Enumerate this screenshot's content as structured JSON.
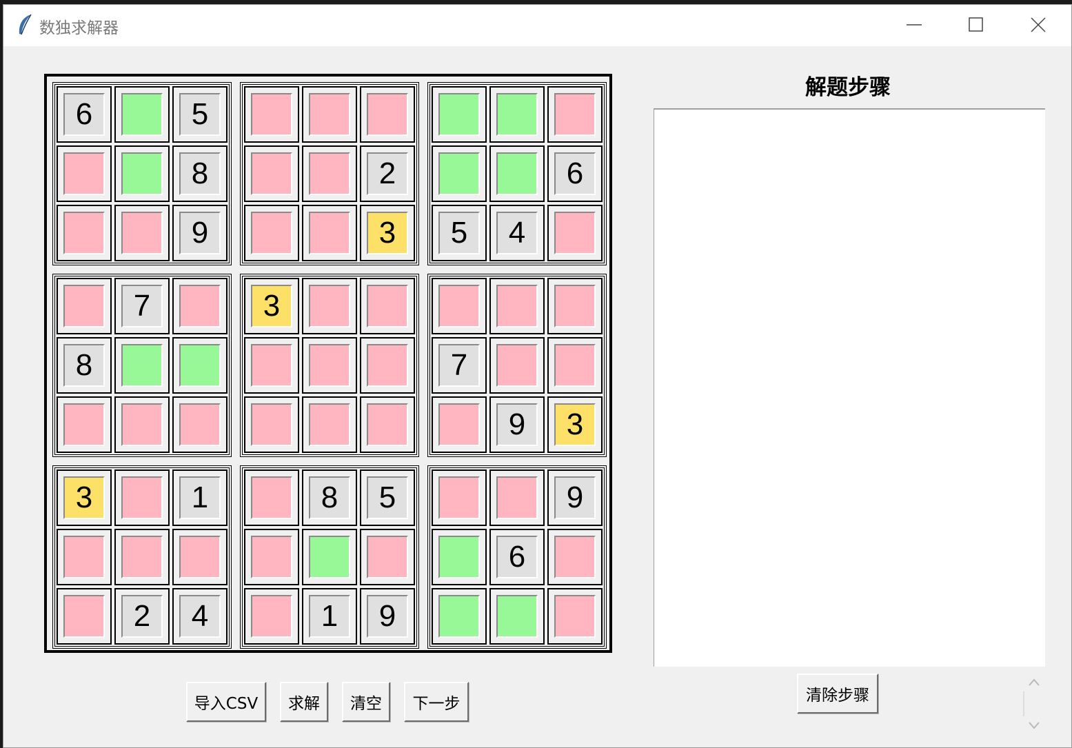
{
  "window": {
    "title": "数独求解器",
    "controls": {
      "minimize_icon": "minimize-icon",
      "maximize_icon": "maximize-icon",
      "close_icon": "close-icon"
    }
  },
  "colors": {
    "given": "#e0e0e0",
    "candidate_green": "#98f898",
    "empty_pink": "#ffb6c1",
    "highlight_yellow": "#fde068"
  },
  "board": {
    "rows": [
      [
        {
          "v": "6",
          "s": "given"
        },
        {
          "v": "",
          "s": "green"
        },
        {
          "v": "5",
          "s": "given"
        },
        {
          "v": "",
          "s": "pink"
        },
        {
          "v": "",
          "s": "pink"
        },
        {
          "v": "",
          "s": "pink"
        },
        {
          "v": "",
          "s": "green"
        },
        {
          "v": "",
          "s": "green"
        },
        {
          "v": "",
          "s": "pink"
        }
      ],
      [
        {
          "v": "",
          "s": "pink"
        },
        {
          "v": "",
          "s": "green"
        },
        {
          "v": "8",
          "s": "given"
        },
        {
          "v": "",
          "s": "pink"
        },
        {
          "v": "",
          "s": "pink"
        },
        {
          "v": "2",
          "s": "given"
        },
        {
          "v": "",
          "s": "green"
        },
        {
          "v": "",
          "s": "green"
        },
        {
          "v": "6",
          "s": "given"
        }
      ],
      [
        {
          "v": "",
          "s": "pink"
        },
        {
          "v": "",
          "s": "pink"
        },
        {
          "v": "9",
          "s": "given"
        },
        {
          "v": "",
          "s": "pink"
        },
        {
          "v": "",
          "s": "pink"
        },
        {
          "v": "3",
          "s": "yellow"
        },
        {
          "v": "5",
          "s": "given"
        },
        {
          "v": "4",
          "s": "given"
        },
        {
          "v": "",
          "s": "pink"
        }
      ],
      [
        {
          "v": "",
          "s": "pink"
        },
        {
          "v": "7",
          "s": "given"
        },
        {
          "v": "",
          "s": "pink"
        },
        {
          "v": "3",
          "s": "yellow"
        },
        {
          "v": "",
          "s": "pink"
        },
        {
          "v": "",
          "s": "pink"
        },
        {
          "v": "",
          "s": "pink"
        },
        {
          "v": "",
          "s": "pink"
        },
        {
          "v": "",
          "s": "pink"
        }
      ],
      [
        {
          "v": "8",
          "s": "given"
        },
        {
          "v": "",
          "s": "green"
        },
        {
          "v": "",
          "s": "green"
        },
        {
          "v": "",
          "s": "pink"
        },
        {
          "v": "",
          "s": "pink"
        },
        {
          "v": "",
          "s": "pink"
        },
        {
          "v": "7",
          "s": "given"
        },
        {
          "v": "",
          "s": "pink"
        },
        {
          "v": "",
          "s": "pink"
        }
      ],
      [
        {
          "v": "",
          "s": "pink"
        },
        {
          "v": "",
          "s": "pink"
        },
        {
          "v": "",
          "s": "pink"
        },
        {
          "v": "",
          "s": "pink"
        },
        {
          "v": "",
          "s": "pink"
        },
        {
          "v": "",
          "s": "pink"
        },
        {
          "v": "",
          "s": "pink"
        },
        {
          "v": "9",
          "s": "given"
        },
        {
          "v": "3",
          "s": "yellow"
        }
      ],
      [
        {
          "v": "3",
          "s": "yellow"
        },
        {
          "v": "",
          "s": "pink"
        },
        {
          "v": "1",
          "s": "given"
        },
        {
          "v": "",
          "s": "pink"
        },
        {
          "v": "8",
          "s": "given"
        },
        {
          "v": "5",
          "s": "given"
        },
        {
          "v": "",
          "s": "pink"
        },
        {
          "v": "",
          "s": "pink"
        },
        {
          "v": "9",
          "s": "given"
        }
      ],
      [
        {
          "v": "",
          "s": "pink"
        },
        {
          "v": "",
          "s": "pink"
        },
        {
          "v": "",
          "s": "pink"
        },
        {
          "v": "",
          "s": "pink"
        },
        {
          "v": "",
          "s": "green"
        },
        {
          "v": "",
          "s": "pink"
        },
        {
          "v": "",
          "s": "green"
        },
        {
          "v": "6",
          "s": "given"
        },
        {
          "v": "",
          "s": "pink"
        }
      ],
      [
        {
          "v": "",
          "s": "pink"
        },
        {
          "v": "2",
          "s": "given"
        },
        {
          "v": "4",
          "s": "given"
        },
        {
          "v": "",
          "s": "pink"
        },
        {
          "v": "1",
          "s": "given"
        },
        {
          "v": "9",
          "s": "given"
        },
        {
          "v": "",
          "s": "green"
        },
        {
          "v": "",
          "s": "green"
        },
        {
          "v": "",
          "s": "pink"
        }
      ]
    ]
  },
  "steps_panel": {
    "title": "解题步骤",
    "content": "",
    "clear_button": "清除步骤"
  },
  "toolbar": {
    "import_label": "导入CSV",
    "solve_label": "求解",
    "clear_label": "清空",
    "next_label": "下一步"
  }
}
